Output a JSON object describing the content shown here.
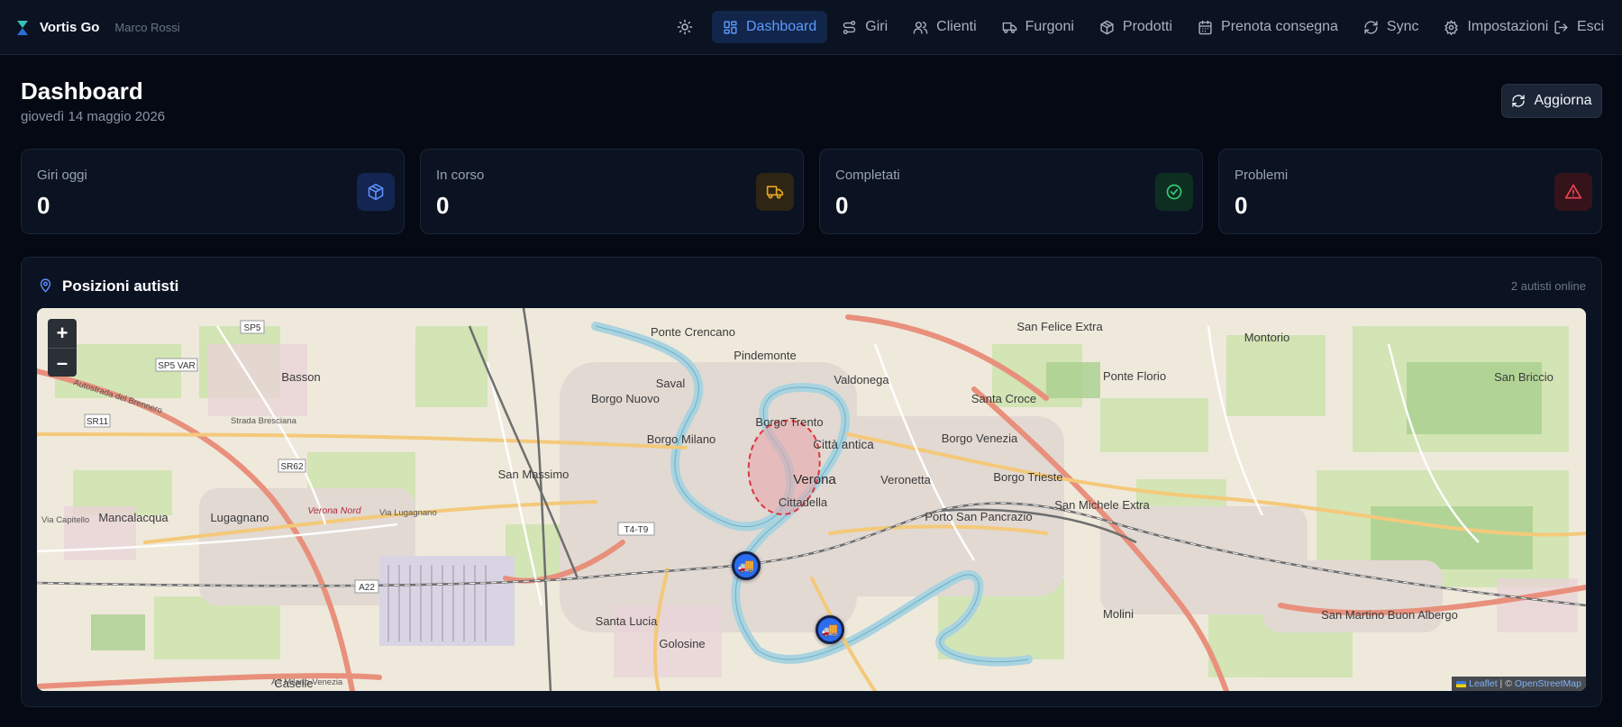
{
  "app": {
    "name": "Vortis Go",
    "user": "Marco Rossi"
  },
  "nav": {
    "theme_icon": "sun-icon",
    "items": [
      {
        "label": "Dashboard",
        "icon": "dashboard-icon",
        "active": true
      },
      {
        "label": "Giri",
        "icon": "route-icon"
      },
      {
        "label": "Clienti",
        "icon": "users-icon"
      },
      {
        "label": "Furgoni",
        "icon": "truck-icon"
      },
      {
        "label": "Prodotti",
        "icon": "package-icon"
      },
      {
        "label": "Prenota consegna",
        "icon": "calendar-icon"
      },
      {
        "label": "Sync",
        "icon": "sync-icon"
      },
      {
        "label": "Impostazioni",
        "icon": "gear-icon"
      }
    ],
    "exit_label": "Esci"
  },
  "header": {
    "title": "Dashboard",
    "date": "giovedì 14 maggio 2026",
    "refresh_label": "Aggiorna"
  },
  "stats": [
    {
      "label": "Giri oggi",
      "value": "0",
      "icon": "package-icon",
      "color": "#5b8ff9"
    },
    {
      "label": "In corso",
      "value": "0",
      "icon": "truck-icon",
      "color": "#e7a521"
    },
    {
      "label": "Completati",
      "value": "0",
      "icon": "check-circle-icon",
      "color": "#2fcf72"
    },
    {
      "label": "Problemi",
      "value": "0",
      "icon": "alert-triangle-icon",
      "color": "#f0444f"
    }
  ],
  "map_panel": {
    "title": "Posizioni autisti",
    "online_note": "2 autisti online",
    "zoom_in": "+",
    "zoom_out": "–",
    "attribution": {
      "leaflet": "Leaflet",
      "separator": " | © ",
      "osm": "OpenStreetMap"
    },
    "drivers": [
      {
        "name": "driver-marker-1",
        "icon": "🚚"
      },
      {
        "name": "driver-marker-2",
        "icon": "🚚"
      }
    ],
    "places": [
      "Ponte Crencano",
      "Pindemonte",
      "Saval",
      "Valdonega",
      "Borgo Nuovo",
      "Borgo Trento",
      "Città antica",
      "Borgo Milano",
      "Verona",
      "Veronetta",
      "Borgo Venezia",
      "Santa Croce",
      "Borgo Trieste",
      "Cittadella",
      "San Massimo",
      "Porto San Pancrazio",
      "San Michele Extra",
      "Basson",
      "Mancalacqua",
      "Lugagnano",
      "Santa Lucia",
      "Golosine",
      "Molini",
      "San Martino Buon Albergo",
      "Ponte Florio",
      "Montorio",
      "San Felice Extra",
      "San Briccio",
      "Caselle",
      "Verona Nord",
      "SP5",
      "SP5 VAR",
      "SR11",
      "SR62",
      "A22",
      "T4-T9",
      "Strada Bresciana",
      "Via Lugagnano",
      "Via Capitello",
      "Autostrada del Brennero",
      "A4 Milano-Venezia"
    ]
  }
}
